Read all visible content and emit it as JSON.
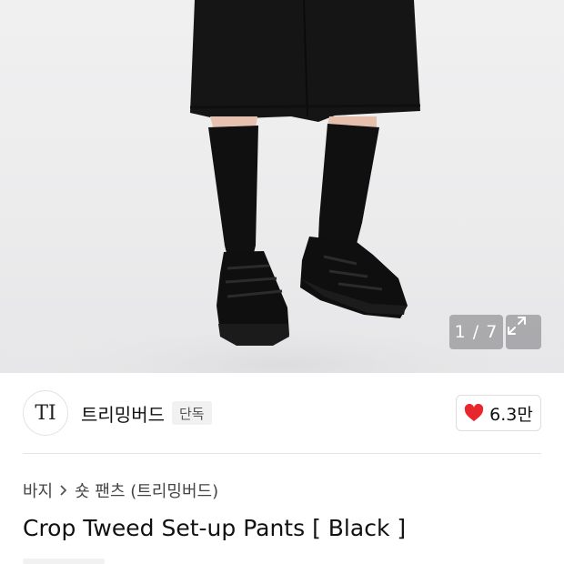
{
  "gallery": {
    "counter": "1 / 7",
    "image_icon": "expand-icon"
  },
  "brand": {
    "logo_text": "TI",
    "name": "트리밍버드",
    "badge": "단독"
  },
  "like": {
    "icon": "heart-icon",
    "count": "6.3만",
    "color": "#e8272d"
  },
  "breadcrumb": {
    "items": [
      "바지",
      "숏 팬츠 (트리밍버드)"
    ],
    "separator_icon": "chevron-right-icon"
  },
  "product": {
    "title": "Crop Tweed Set-up Pants [ Black ]"
  }
}
